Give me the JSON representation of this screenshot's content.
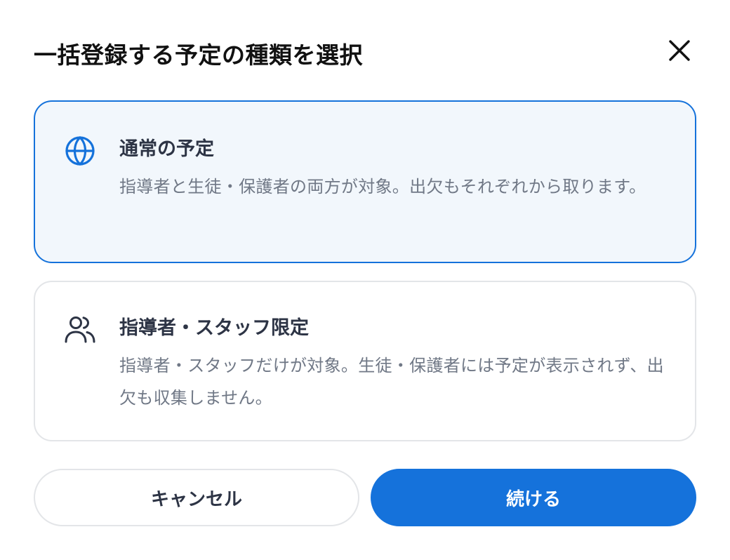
{
  "dialog": {
    "title": "一括登録する予定の種類を選択",
    "close_icon": "close-icon"
  },
  "options": [
    {
      "icon": "globe-icon",
      "title": "通常の予定",
      "description": "指導者と生徒・保護者の両方が対象。出欠もそれぞれから取ります。",
      "selected": true
    },
    {
      "icon": "users-icon",
      "title": "指導者・スタッフ限定",
      "description": "指導者・スタッフだけが対象。生徒・保護者には予定が表示されず、出欠も収集しません。",
      "selected": false
    }
  ],
  "actions": {
    "cancel_label": "キャンセル",
    "continue_label": "続ける"
  },
  "colors": {
    "accent": "#1572db",
    "selected_background": "#f2f7fc",
    "border": "#e3e5e8",
    "title_text": "#111111",
    "body_text": "#2d3445",
    "muted_text": "#707886"
  }
}
